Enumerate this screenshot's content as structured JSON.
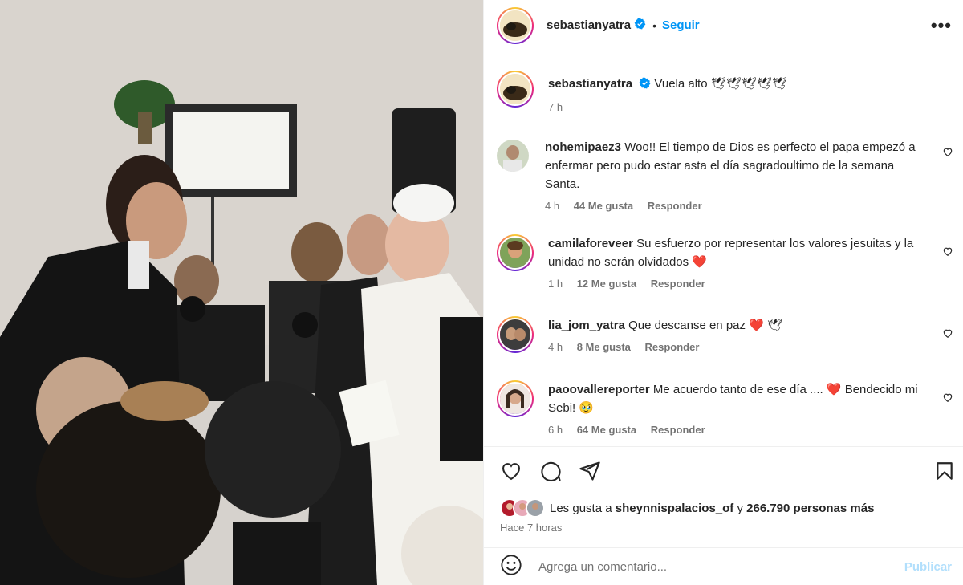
{
  "post": {
    "username": "sebastianyatra",
    "follow_label": "Seguir",
    "more_label": "•••",
    "caption_text": "Vuela alto 🕊🕊🕊🕊🕊",
    "caption_time": "7 h"
  },
  "comments": [
    {
      "username": "nohemipaez3",
      "text": "Woo!! El tiempo de Dios es perfecto el papa empezó a enfermar pero pudo estar asta el día sagradoultimo de la semana Santa.",
      "time": "4 h",
      "likes": "44 Me gusta",
      "reply": "Responder"
    },
    {
      "username": "camilaforeveer",
      "text": "Su esfuerzo por representar los valores jesuitas y la unidad no serán olvidados ❤️",
      "time": "1 h",
      "likes": "12 Me gusta",
      "reply": "Responder"
    },
    {
      "username": "lia_jom_yatra",
      "text": "Que descanse en paz ❤️ 🕊",
      "time": "4 h",
      "likes": "8 Me gusta",
      "reply": "Responder"
    },
    {
      "username": "paoovallereporter",
      "text": "Me acuerdo tanto de ese día .... ❤️ Bendecido mi Sebi! 🥹",
      "time": "6 h",
      "likes": "64 Me gusta",
      "reply": "Responder"
    }
  ],
  "likes": {
    "prefix": "Les gusta a",
    "user": "sheynnispalacios_of",
    "connector": "y",
    "count_text": "266.790 personas más"
  },
  "time_ago": "Hace 7 horas",
  "add_comment": {
    "placeholder": "Agrega un comentario...",
    "publish_label": "Publicar"
  },
  "icons": {
    "like": "heart-icon",
    "comment": "comment-icon",
    "share": "share-icon",
    "save": "bookmark-icon",
    "emoji": "emoji-icon",
    "verified": "verified-badge-icon"
  },
  "colors": {
    "accent": "#0095f6",
    "text": "#262626",
    "muted": "#737373",
    "publish_disabled": "#b2dffc",
    "heart": "#ed1c24"
  }
}
